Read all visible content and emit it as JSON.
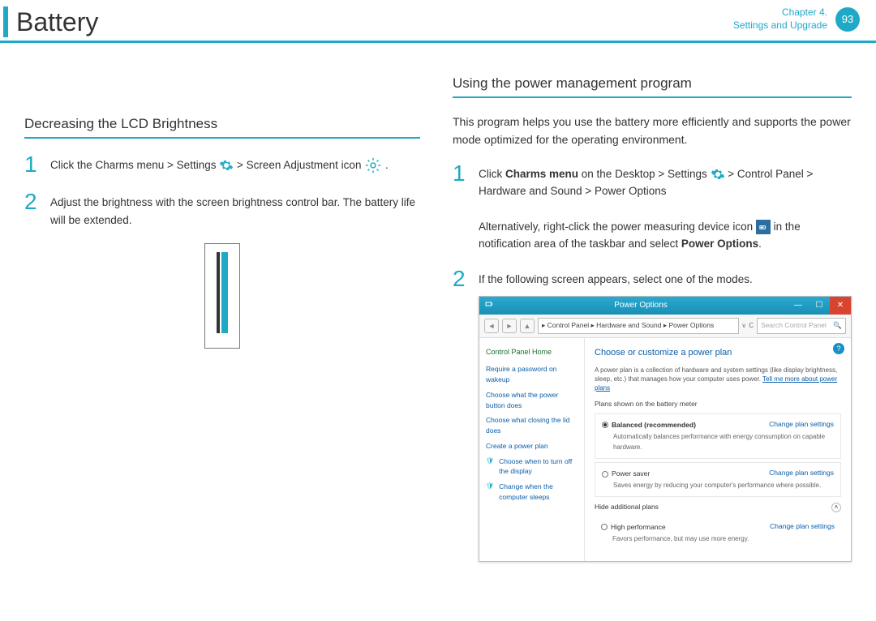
{
  "header": {
    "title": "Battery",
    "chapter_line1": "Chapter 4.",
    "chapter_line2": "Settings and Upgrade",
    "page_number": "93"
  },
  "left": {
    "heading": "Decreasing the LCD Brightness",
    "step1_pre": "Click the",
    "step1_charms": " Charms menu > Settings ",
    "step1_post": " > Screen Adjustment icon ",
    "step1_end": ".",
    "step2": "Adjust the brightness with the screen brightness control bar. The battery life will be extended."
  },
  "right": {
    "heading": "Using the power management program",
    "intro": "This program helps you use the battery more efficiently and supports the power mode optimized for the operating environment.",
    "step1_a": "Click ",
    "step1_b": "Charms menu",
    "step1_c": " on the Desktop ",
    "step1_d": "> Settings ",
    "step1_e": " > Control Panel > Hardware and Sound > Power Options",
    "step1_alt_a": "Alternatively, right-click the power measuring device icon ",
    "step1_alt_b": " in the notification area of the taskbar and select ",
    "step1_alt_c": "Power Options",
    "step1_alt_d": ".",
    "step2": "If the following screen appears, select one of the modes."
  },
  "screenshot": {
    "title": "Power Options",
    "breadcrumbs": "▸ Control Panel ▸ Hardware and Sound ▸ Power Options",
    "search_placeholder": "Search Control Panel",
    "side_heading": "Control Panel Home",
    "side_links": [
      "Require a password on wakeup",
      "Choose what the power button does",
      "Choose what closing the lid does",
      "Create a power plan",
      "Choose when to turn off the display",
      "Change when the computer sleeps"
    ],
    "main_heading": "Choose or customize a power plan",
    "main_desc_a": "A power plan is a collection of hardware and system settings (like display brightness, sleep, etc.) that manages how your computer uses power. ",
    "main_desc_link": "Tell me more about power plans",
    "sub_label": "Plans shown on the battery meter",
    "plan1_name": "Balanced (recommended)",
    "plan1_desc": "Automatically balances performance with energy consumption on capable hardware.",
    "plan2_name": "Power saver",
    "plan2_desc": "Saves energy by reducing your computer's performance where possible.",
    "change_link": "Change plan settings",
    "hide_label": "Hide additional plans",
    "plan3_name": "High performance",
    "plan3_desc": "Favors performance, but may use more energy."
  },
  "nums": {
    "one": "1",
    "two": "2"
  }
}
